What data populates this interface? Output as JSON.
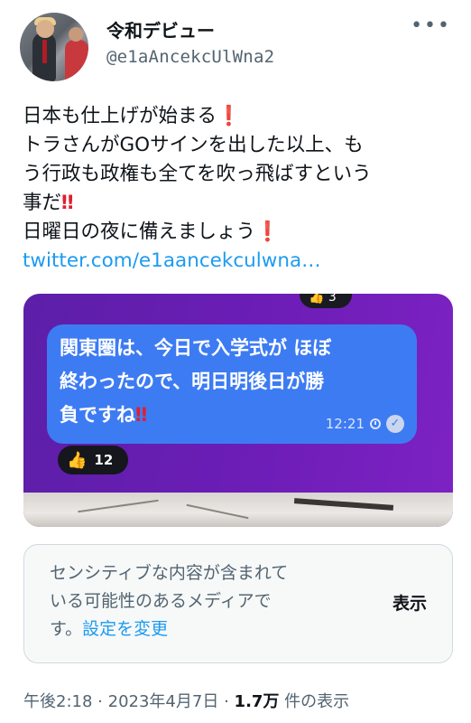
{
  "user": {
    "display_name": "令和デビュー",
    "handle": "@e1aAncekcUlWna2",
    "more_icon": "•••"
  },
  "tweet": {
    "lines": [
      "日本も仕上げが始まる",
      "トラさんがGOサインを出した以上、も",
      "う行政も政権も全てを吹っ飛ばすという",
      "事だ",
      "日曜日の夜に備えましょう"
    ],
    "excl_single": "❗",
    "excl_double": "‼",
    "link": "twitter.com/e1aancekculwna…"
  },
  "media": {
    "top_reaction": "👍 3",
    "bubble_lines": [
      "関東圏は、今日で入学式が ほぼ",
      "終わったので、明日明後日が勝",
      "負ですね"
    ],
    "bubble_excl": "‼",
    "time": "12:21",
    "reaction_icon": "👍",
    "reaction_count": "12"
  },
  "sensitive": {
    "line1": "センシティブな内容が含まれて",
    "line2": "いる可能性のあるメディアで",
    "line3_prefix": "す。",
    "settings_link": "設定を変更",
    "show_button": "表示"
  },
  "meta": {
    "time": "午後2:18",
    "sep": "·",
    "date": "2023年4月7日",
    "views": "1.7万",
    "views_suffix": "件の表示"
  },
  "colors": {
    "accent": "#1d9bf0",
    "text": "#0f1419",
    "muted": "#536471",
    "excl": "#e0202f",
    "media_bg": "#6b1db5",
    "bubble": "#3d7bf3"
  }
}
